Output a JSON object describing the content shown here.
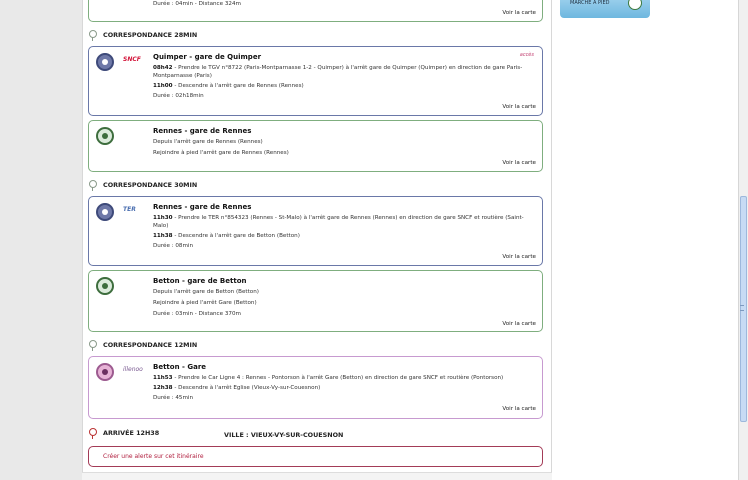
{
  "top_card": {
    "line": "Durée : 04min - Distance 324m",
    "map": "Voir la carte"
  },
  "promo": {
    "text": "MARCHE À PIED"
  },
  "corr1": "CORRESPONDANCE 28MIN",
  "card1": {
    "logo": "SNCF",
    "accessible": "accès",
    "title": "Quimper - gare de Quimper",
    "time1": "08h42",
    "text1": " - Prendre le TGV  n°8722  (Paris-Montparnasse 1-2 - Quimper) à l'arrêt gare de Quimper (Quimper) en direction de gare Paris-Montparnasse (Paris)",
    "time2": "11h00",
    "text2": " - Descendre à l'arrêt gare de Rennes (Rennes)",
    "duration": "Durée : 02h18min",
    "map": "Voir la carte"
  },
  "card2": {
    "title": "Rennes - gare de Rennes",
    "line1": "Depuis l'arrêt gare de Rennes (Rennes)",
    "line2": "Rejoindre à pied l'arrêt gare de Rennes (Rennes)",
    "map": "Voir la carte"
  },
  "corr2": "CORRESPONDANCE 30MIN",
  "card3": {
    "logo": "TER",
    "title": "Rennes - gare de Rennes",
    "time1": "11h30",
    "text1": " - Prendre le TER  n°854323  (Rennes - St-Malo) à l'arrêt gare de Rennes (Rennes) en direction de gare SNCF et routière (Saint-Malo)",
    "time2": "11h38",
    "text2": " - Descendre à l'arrêt gare de Betton (Betton)",
    "duration": "Durée : 08min",
    "map": "Voir la carte"
  },
  "card4": {
    "title": "Betton - gare de Betton",
    "line1": "Depuis l'arrêt gare de Betton (Betton)",
    "line2": "Rejoindre à pied l'arrêt Gare (Betton)",
    "line3": "Durée : 03min - Distance  370m",
    "map": "Voir la carte"
  },
  "corr3": "CORRESPONDANCE 12MIN",
  "card5": {
    "logo": "illenoo",
    "title": "Betton - Gare",
    "time1": "11h53",
    "text1": " - Prendre le Car Ligne 4  : Rennes - Pontorson à l'arrêt Gare (Betton) en direction de gare SNCF et routière (Pontorson)",
    "time2": "12h38",
    "text2": " - Descendre à l'arrêt Eglise (Vieux-Vy-sur-Couesnon)",
    "duration": "Durée : 45min",
    "map": "Voir la carte"
  },
  "arrival": {
    "label": "ARRIVÉE 12H38",
    "city": "VILLE : VIEUX-VY-SUR-COUESNON"
  },
  "alert": "Créer une alerte sur cet itinéraire",
  "colors": {
    "walk_border": "#7fae7f",
    "train_border": "#6a78a8",
    "bus_border": "#c79ad0",
    "alert": "#b01e3e"
  }
}
